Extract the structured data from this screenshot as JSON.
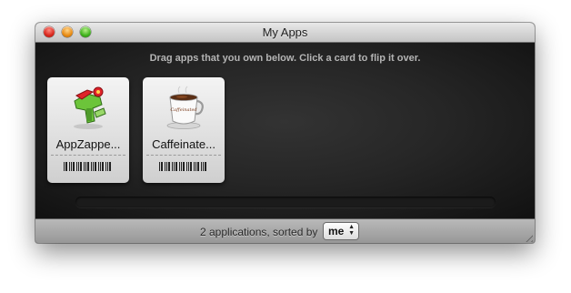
{
  "window": {
    "title": "My Apps"
  },
  "content": {
    "instructions": "Drag apps that you own below. Click a card to flip it over.",
    "cards": [
      {
        "name": "AppZappe...",
        "icon": "zapper-gun-icon"
      },
      {
        "name": "Caffeinate...",
        "icon": "coffee-cup-icon",
        "cup_text": "Caffeinated"
      }
    ]
  },
  "footer": {
    "status_text": "2 applications, sorted by",
    "sort_value": "me"
  },
  "colors": {
    "content_bg": "#262626",
    "titlebar": "#c4c4c4",
    "close": "#d8261c",
    "minimize": "#e88a12",
    "zoom": "#3fb21c"
  }
}
